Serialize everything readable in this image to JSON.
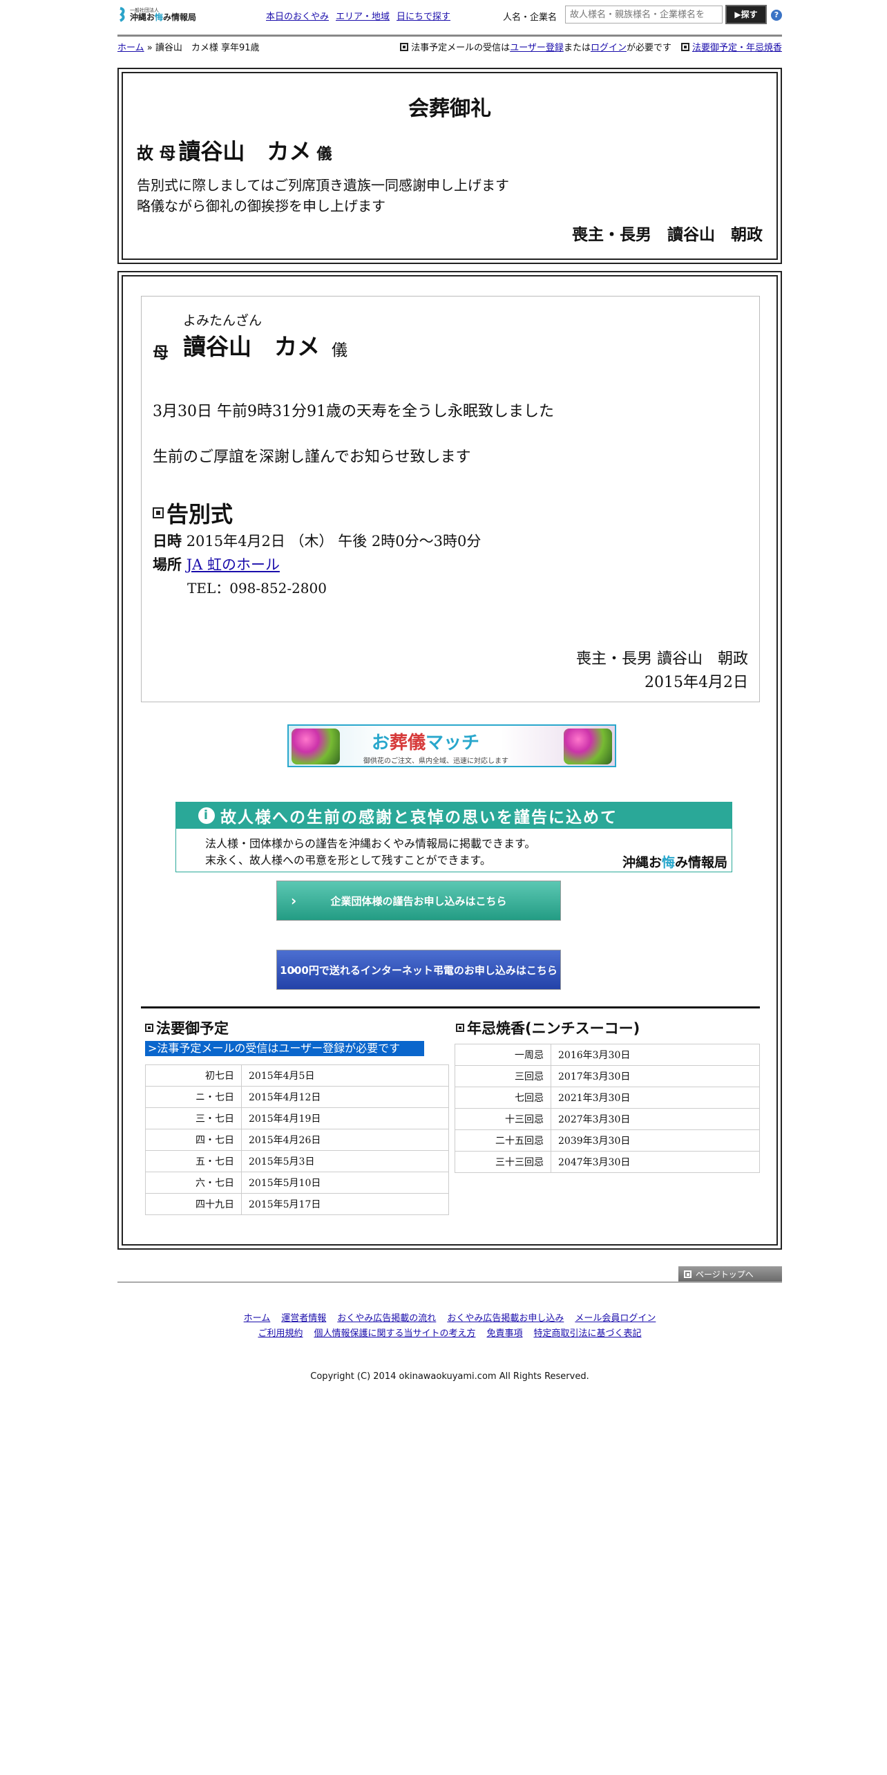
{
  "header": {
    "logo_small": "一般社団法人",
    "logo_pre": "沖縄お",
    "logo_hl": "悔",
    "logo_post": "み情報局",
    "nav": [
      "本日のおくやみ",
      "エリア・地域",
      "日にちで探す"
    ],
    "search_label": "人名・企業名",
    "search_placeholder": "故人様名・親族様名・企業様名を",
    "search_button": "探す",
    "help": "?"
  },
  "breadcrumb": {
    "home": "ホーム",
    "sep": "»",
    "current": "讀谷山　カメ様 享年91歳",
    "note_pre": "法事予定メールの受信は",
    "note_link1": "ユーザー登録",
    "note_mid": "または",
    "note_link2": "ログイン",
    "note_post": "が必要です",
    "right_link": "法要御予定・年忌焼香"
  },
  "thanks": {
    "title": "会葬御礼",
    "prefix": "故 母",
    "name": "讀谷山　カメ",
    "suffix": "儀",
    "line1": "告別式に際しましてはご列席頂き遺族一同感謝申し上げます",
    "line2": "略儀ながら御礼の御挨拶を申し上げます",
    "sign": "喪主・長男　讀谷山　朝政"
  },
  "notice": {
    "ruby": "よみたんざん",
    "relation": "母",
    "name": "讀谷山　カメ",
    "suffix": "儀",
    "line1": "3月30日 午前9時31分91歳の天寿を全うし永眠致しました",
    "line2": "生前のご厚誼を深謝し謹んでお知らせ致します",
    "section": "告別式",
    "date_label": "日時",
    "date_value": "2015年4月2日 （木） 午後 2時0分～3時0分",
    "place_label": "場所",
    "place_link": "JA 虹のホール",
    "tel": "TEL：098-852-2800",
    "sign": "喪主・長男 讀谷山　朝政",
    "sign_date": "2015年4月2日"
  },
  "banners": {
    "osogi_pre": "お",
    "osogi_accent": "葬儀",
    "osogi_post": "マッチ",
    "osogi_sub": "御供花のご注文、県内全域、迅速に対応します",
    "condol_title": "故人様への生前の感謝と哀悼の思いを謹告に込めて",
    "condol_line1": "法人様・団体様からの謹告を沖縄おくやみ情報局に掲載できます。",
    "condol_line2": "末永く、故人様への弔意を形として残すことができます。",
    "condol_brand_pre": "沖縄お",
    "condol_brand_hl": "悔",
    "condol_brand_post": "み情報局",
    "btn_green": "企業団体様の謹告お申し込みはこちら",
    "btn_blue": "1000円で送れるインターネット弔電のお申し込みはこちら"
  },
  "houyou": {
    "title": "法要御予定",
    "note": ">法事予定メールの受信はユーザー登録が必要です",
    "rows": [
      [
        "初七日",
        "2015年4月5日"
      ],
      [
        "ニ・七日",
        "2015年4月12日"
      ],
      [
        "三・七日",
        "2015年4月19日"
      ],
      [
        "四・七日",
        "2015年4月26日"
      ],
      [
        "五・七日",
        "2015年5月3日"
      ],
      [
        "六・七日",
        "2015年5月10日"
      ],
      [
        "四十九日",
        "2015年5月17日"
      ]
    ]
  },
  "nenki": {
    "title": "年忌焼香(ニンチスーコー)",
    "rows": [
      [
        "一周忌",
        "2016年3月30日"
      ],
      [
        "三回忌",
        "2017年3月30日"
      ],
      [
        "七回忌",
        "2021年3月30日"
      ],
      [
        "十三回忌",
        "2027年3月30日"
      ],
      [
        "二十五回忌",
        "2039年3月30日"
      ],
      [
        "三十三回忌",
        "2047年3月30日"
      ]
    ]
  },
  "footer": {
    "pagetop": "ページトップへ",
    "links1": [
      "ホーム",
      "運営者情報",
      "おくやみ広告掲載の流れ",
      "おくやみ広告掲載お申し込み",
      "メール会員ログイン"
    ],
    "links2": [
      "ご利用規約",
      "個人情報保護に関する当サイトの考え方",
      "免責事項",
      "特定商取引法に基づく表記"
    ],
    "copyright": "Copyright (C) 2014 okinawaokuyami.com All Rights Reserved."
  },
  "colors": {
    "accent": "#2aa898",
    "link": "#1a0dab",
    "blue_note": "#0a66cc",
    "brand": "#29a7cc"
  }
}
